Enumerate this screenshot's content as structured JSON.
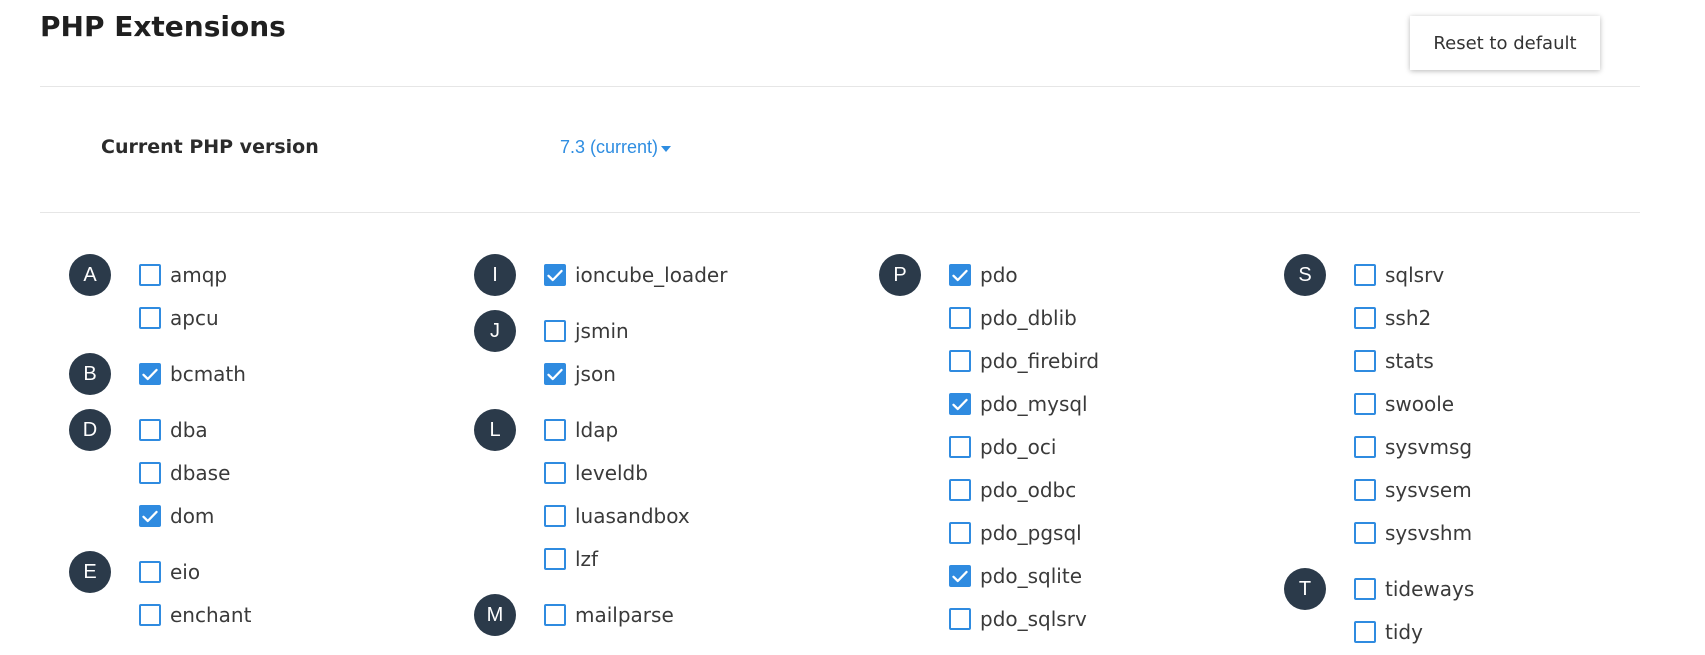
{
  "header": {
    "title": "PHP Extensions",
    "reset_label": "Reset to default"
  },
  "version": {
    "label": "Current PHP version",
    "value": "7.3 (current)"
  },
  "colors": {
    "accent": "#2f8be0",
    "badge": "#2b3a4a"
  },
  "columns": [
    {
      "groups": [
        {
          "letter": "A",
          "items": [
            {
              "name": "amqp",
              "checked": false
            },
            {
              "name": "apcu",
              "checked": false
            }
          ]
        },
        {
          "letter": "B",
          "items": [
            {
              "name": "bcmath",
              "checked": true
            }
          ]
        },
        {
          "letter": "D",
          "items": [
            {
              "name": "dba",
              "checked": false
            },
            {
              "name": "dbase",
              "checked": false
            },
            {
              "name": "dom",
              "checked": true
            }
          ]
        },
        {
          "letter": "E",
          "items": [
            {
              "name": "eio",
              "checked": false
            },
            {
              "name": "enchant",
              "checked": false
            }
          ]
        }
      ]
    },
    {
      "groups": [
        {
          "letter": "I",
          "items": [
            {
              "name": "ioncube_loader",
              "checked": true
            }
          ]
        },
        {
          "letter": "J",
          "items": [
            {
              "name": "jsmin",
              "checked": false
            },
            {
              "name": "json",
              "checked": true
            }
          ]
        },
        {
          "letter": "L",
          "items": [
            {
              "name": "ldap",
              "checked": false
            },
            {
              "name": "leveldb",
              "checked": false
            },
            {
              "name": "luasandbox",
              "checked": false
            },
            {
              "name": "lzf",
              "checked": false
            }
          ]
        },
        {
          "letter": "M",
          "items": [
            {
              "name": "mailparse",
              "checked": false
            }
          ]
        }
      ]
    },
    {
      "groups": [
        {
          "letter": "P",
          "items": [
            {
              "name": "pdo",
              "checked": true
            },
            {
              "name": "pdo_dblib",
              "checked": false
            },
            {
              "name": "pdo_firebird",
              "checked": false
            },
            {
              "name": "pdo_mysql",
              "checked": true
            },
            {
              "name": "pdo_oci",
              "checked": false
            },
            {
              "name": "pdo_odbc",
              "checked": false
            },
            {
              "name": "pdo_pgsql",
              "checked": false
            },
            {
              "name": "pdo_sqlite",
              "checked": true
            },
            {
              "name": "pdo_sqlsrv",
              "checked": false
            }
          ]
        }
      ]
    },
    {
      "groups": [
        {
          "letter": "S",
          "items": [
            {
              "name": "sqlsrv",
              "checked": false
            },
            {
              "name": "ssh2",
              "checked": false
            },
            {
              "name": "stats",
              "checked": false
            },
            {
              "name": "swoole",
              "checked": false
            },
            {
              "name": "sysvmsg",
              "checked": false
            },
            {
              "name": "sysvsem",
              "checked": false
            },
            {
              "name": "sysvshm",
              "checked": false
            }
          ]
        },
        {
          "letter": "T",
          "items": [
            {
              "name": "tideways",
              "checked": false
            },
            {
              "name": "tidy",
              "checked": false
            }
          ]
        }
      ]
    }
  ]
}
